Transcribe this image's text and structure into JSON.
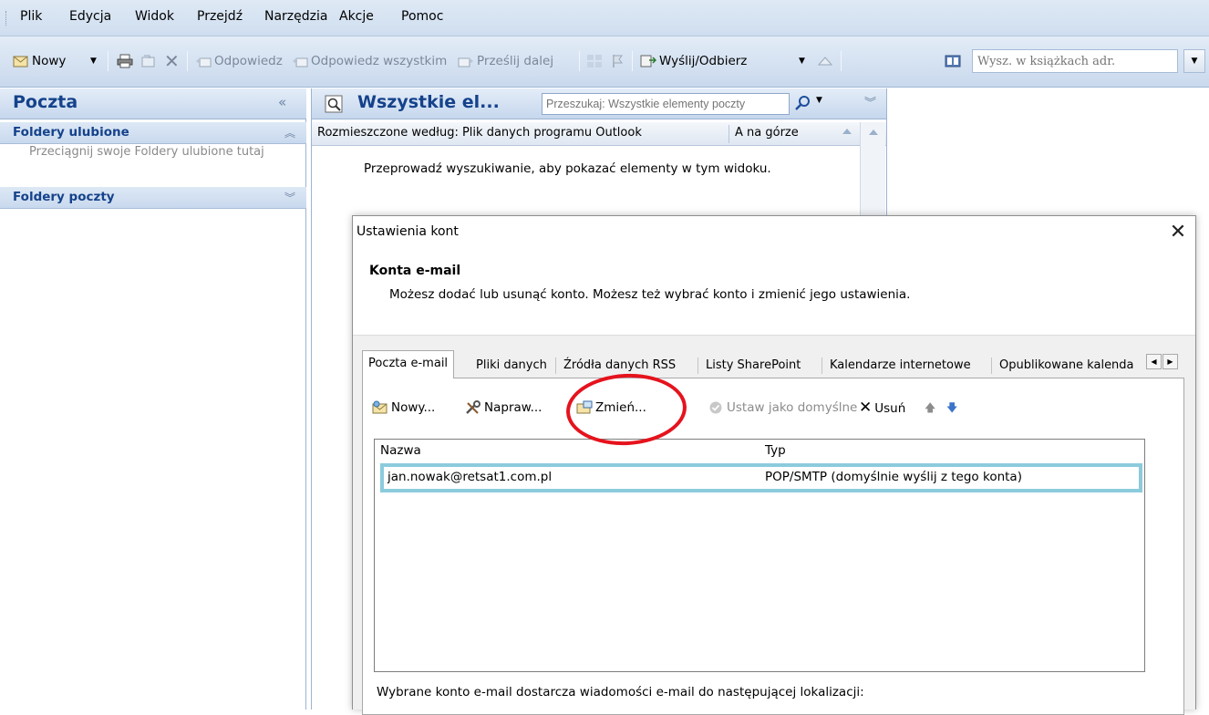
{
  "menu": {
    "items": [
      "Plik",
      "Edycja",
      "Widok",
      "Przejdź",
      "Narzędzia",
      "Akcje",
      "Pomoc"
    ]
  },
  "toolbar": {
    "new_label": "Nowy",
    "reply_label": "Odpowiedz",
    "reply_all_label": "Odpowiedz wszystkim",
    "forward_label": "Prześlij dalej",
    "send_receive_label": "Wyślij/Odbierz",
    "address_search_placeholder": "Wysz. w książkach adr."
  },
  "nav": {
    "title": "Poczta",
    "favorites": {
      "title": "Foldery ulubione",
      "hint": "Przeciągnij swoje Foldery ulubione tutaj"
    },
    "mail_folders": {
      "title": "Foldery poczty"
    }
  },
  "middle": {
    "title": "Wszystkie el...",
    "search_placeholder": "Przeszukaj: Wszystkie elementy poczty",
    "arrange_label": "Rozmieszczone według: Plik danych programu Outlook",
    "sort_order": "A na górze",
    "empty_hint": "Przeprowadź wyszukiwanie, aby pokazać elementy w tym widoku."
  },
  "dialog": {
    "title": "Ustawienia kont",
    "close_glyph": "✕",
    "header_title": "Konta e-mail",
    "header_desc": "Możesz dodać lub usunąć konto. Możesz też wybrać konto i zmienić jego ustawienia.",
    "tabs": [
      "Poczta e-mail",
      "Pliki danych",
      "Źródła danych RSS",
      "Listy SharePoint",
      "Kalendarze internetowe",
      "Opublikowane kalenda"
    ],
    "active_tab": "Poczta e-mail",
    "tools": {
      "new": "Nowy...",
      "repair": "Napraw...",
      "change": "Zmień...",
      "set_default": "Ustaw jako domyślne",
      "remove": "Usuń"
    },
    "table": {
      "columns": [
        "Nazwa",
        "Typ"
      ],
      "rows": [
        {
          "name": "jan.nowak@retsat1.com.pl",
          "type": "POP/SMTP (domyślnie wyślij z tego konta)"
        }
      ]
    },
    "footer": "Wybrane konto e-mail dostarcza wiadomości e-mail do następującej lokalizacji:"
  },
  "annotation": {
    "circle_color": "#e5131d"
  }
}
